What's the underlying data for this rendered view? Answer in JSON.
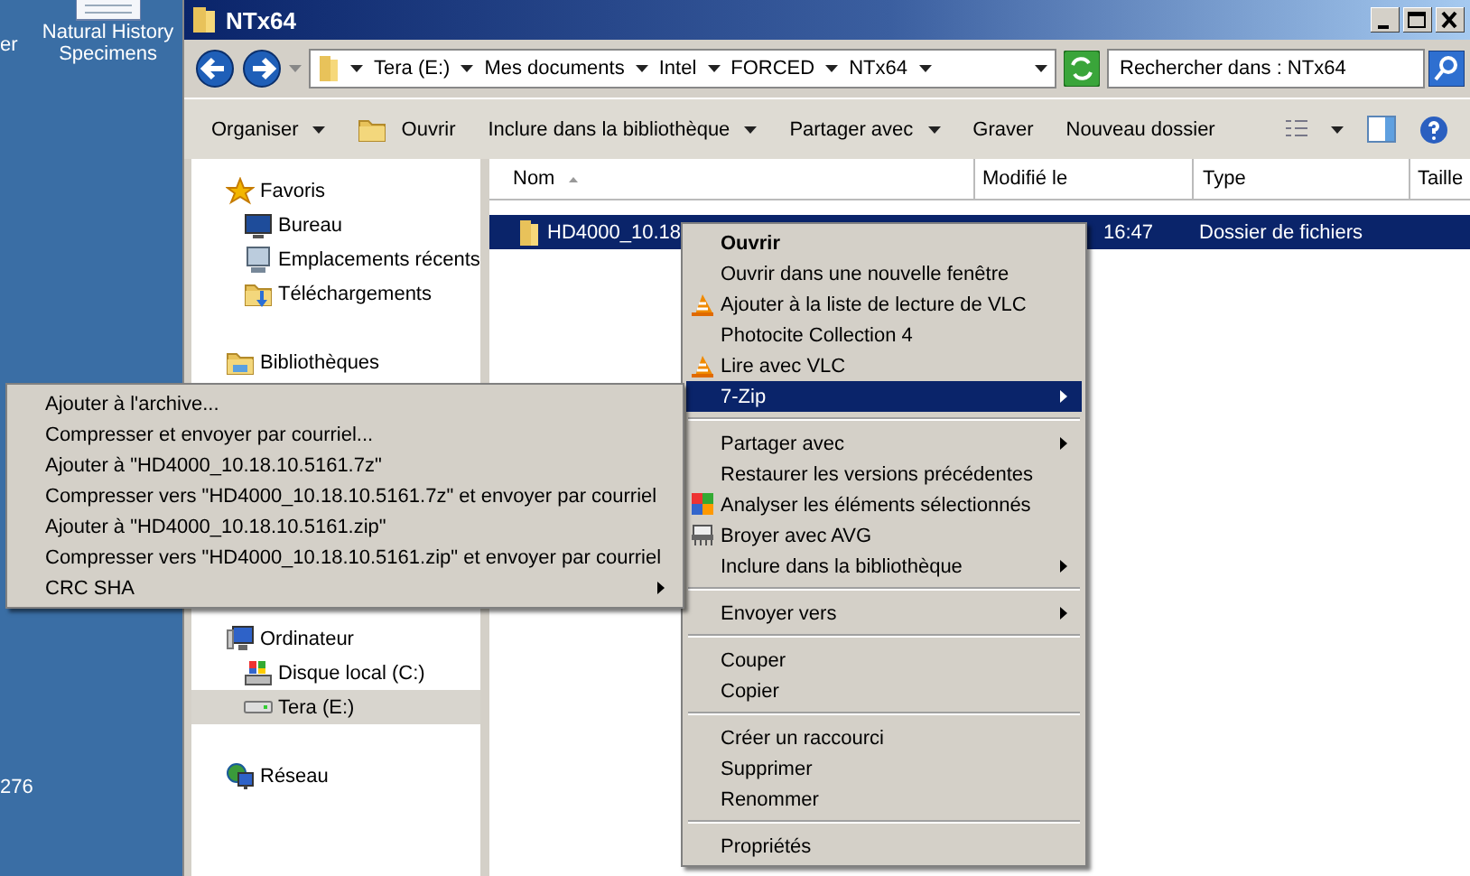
{
  "desktop": {
    "items": [
      {
        "label": "er",
        "kind": "cut"
      },
      {
        "label": "Natural History Specimens",
        "kind": "document"
      }
    ],
    "bottom_label": "276"
  },
  "window": {
    "title": "NTx64"
  },
  "address_bar": {
    "segments": [
      "Tera (E:)",
      "Mes documents",
      "Intel",
      "FORCED",
      "NTx64"
    ],
    "search": {
      "placeholder": "Rechercher dans : NTx64"
    }
  },
  "toolbar": [
    {
      "label": "Organiser",
      "dropdown": true,
      "kind": "text"
    },
    {
      "label": "Ouvrir",
      "dropdown": false,
      "kind": "open"
    },
    {
      "label": "Inclure dans la bibliothèque",
      "dropdown": true,
      "kind": "text"
    },
    {
      "label": "Partager avec",
      "dropdown": true,
      "kind": "text"
    },
    {
      "label": "Graver",
      "dropdown": false,
      "kind": "text"
    },
    {
      "label": "Nouveau dossier",
      "dropdown": false,
      "kind": "text"
    }
  ],
  "sidebar": {
    "groups": [
      {
        "label": "Favoris",
        "children": [
          {
            "label": "Bureau",
            "selected": false
          },
          {
            "label": "Emplacements récents",
            "selected": false
          },
          {
            "label": "Téléchargements",
            "selected": false
          }
        ]
      },
      {
        "label": "Bibliothèques"
      },
      {
        "label": "Ordinateur",
        "children": [
          {
            "label": "Disque local (C:)",
            "selected": false
          },
          {
            "label": "Tera (E:)",
            "selected": true
          }
        ]
      },
      {
        "label": "Réseau"
      }
    ]
  },
  "table": {
    "columns": [
      "Nom",
      "Modifié le",
      "Type",
      "Taille"
    ],
    "rows": [
      {
        "name": "HD4000_10.18",
        "modified": "16:47",
        "type": "Dossier de fichiers",
        "selected": true
      }
    ]
  },
  "context_menu": {
    "items": [
      {
        "kind": "item",
        "label": "Ouvrir",
        "default": true,
        "submenu": false,
        "selected": false
      },
      {
        "kind": "item",
        "label": "Ouvrir dans une nouvelle fenêtre",
        "default": false,
        "submenu": false,
        "selected": false
      },
      {
        "kind": "item",
        "label": "Ajouter à la liste de lecture de VLC",
        "default": false,
        "submenu": false,
        "selected": false
      },
      {
        "kind": "item",
        "label": "Photocite Collection 4",
        "default": false,
        "submenu": false,
        "selected": false
      },
      {
        "kind": "item",
        "label": "Lire avec VLC",
        "default": false,
        "submenu": false,
        "selected": false
      },
      {
        "kind": "item",
        "label": "7-Zip",
        "default": false,
        "submenu": true,
        "selected": true
      },
      {
        "kind": "separator"
      },
      {
        "kind": "item",
        "label": "Partager avec",
        "default": false,
        "submenu": true,
        "selected": false
      },
      {
        "kind": "item",
        "label": "Restaurer les versions précédentes",
        "default": false,
        "submenu": false,
        "selected": false
      },
      {
        "kind": "item",
        "label": "Analyser les éléments sélectionnés",
        "default": false,
        "submenu": false,
        "selected": false
      },
      {
        "kind": "item",
        "label": "Broyer avec AVG",
        "default": false,
        "submenu": false,
        "selected": false
      },
      {
        "kind": "item",
        "label": "Inclure dans la bibliothèque",
        "default": false,
        "submenu": true,
        "selected": false
      },
      {
        "kind": "separator"
      },
      {
        "kind": "item",
        "label": "Envoyer vers",
        "default": false,
        "submenu": true,
        "selected": false
      },
      {
        "kind": "separator"
      },
      {
        "kind": "item",
        "label": "Couper",
        "default": false,
        "submenu": false,
        "selected": false
      },
      {
        "kind": "item",
        "label": "Copier",
        "default": false,
        "submenu": false,
        "selected": false
      },
      {
        "kind": "separator"
      },
      {
        "kind": "item",
        "label": "Créer un raccourci",
        "default": false,
        "submenu": false,
        "selected": false
      },
      {
        "kind": "item",
        "label": "Supprimer",
        "default": false,
        "submenu": false,
        "selected": false
      },
      {
        "kind": "item",
        "label": "Renommer",
        "default": false,
        "submenu": false,
        "selected": false
      },
      {
        "kind": "separator"
      },
      {
        "kind": "item",
        "label": "Propriétés",
        "default": false,
        "submenu": false,
        "selected": false
      }
    ]
  },
  "submenu": {
    "items": [
      {
        "kind": "item",
        "label": "Ajouter à l'archive...",
        "default": false,
        "submenu": false,
        "selected": false
      },
      {
        "kind": "item",
        "label": "Compresser et envoyer par courriel...",
        "default": false,
        "submenu": false,
        "selected": false
      },
      {
        "kind": "item",
        "label": "Ajouter à \"HD4000_10.18.10.5161.7z\"",
        "default": false,
        "submenu": false,
        "selected": false
      },
      {
        "kind": "item",
        "label": "Compresser vers \"HD4000_10.18.10.5161.7z\" et envoyer par courriel",
        "default": false,
        "submenu": false,
        "selected": false
      },
      {
        "kind": "item",
        "label": "Ajouter à \"HD4000_10.18.10.5161.zip\"",
        "default": false,
        "submenu": false,
        "selected": false
      },
      {
        "kind": "item",
        "label": "Compresser vers \"HD4000_10.18.10.5161.zip\" et envoyer par courriel",
        "default": false,
        "submenu": false,
        "selected": false
      },
      {
        "kind": "item",
        "label": "CRC SHA",
        "default": false,
        "submenu": true,
        "selected": false
      }
    ]
  }
}
